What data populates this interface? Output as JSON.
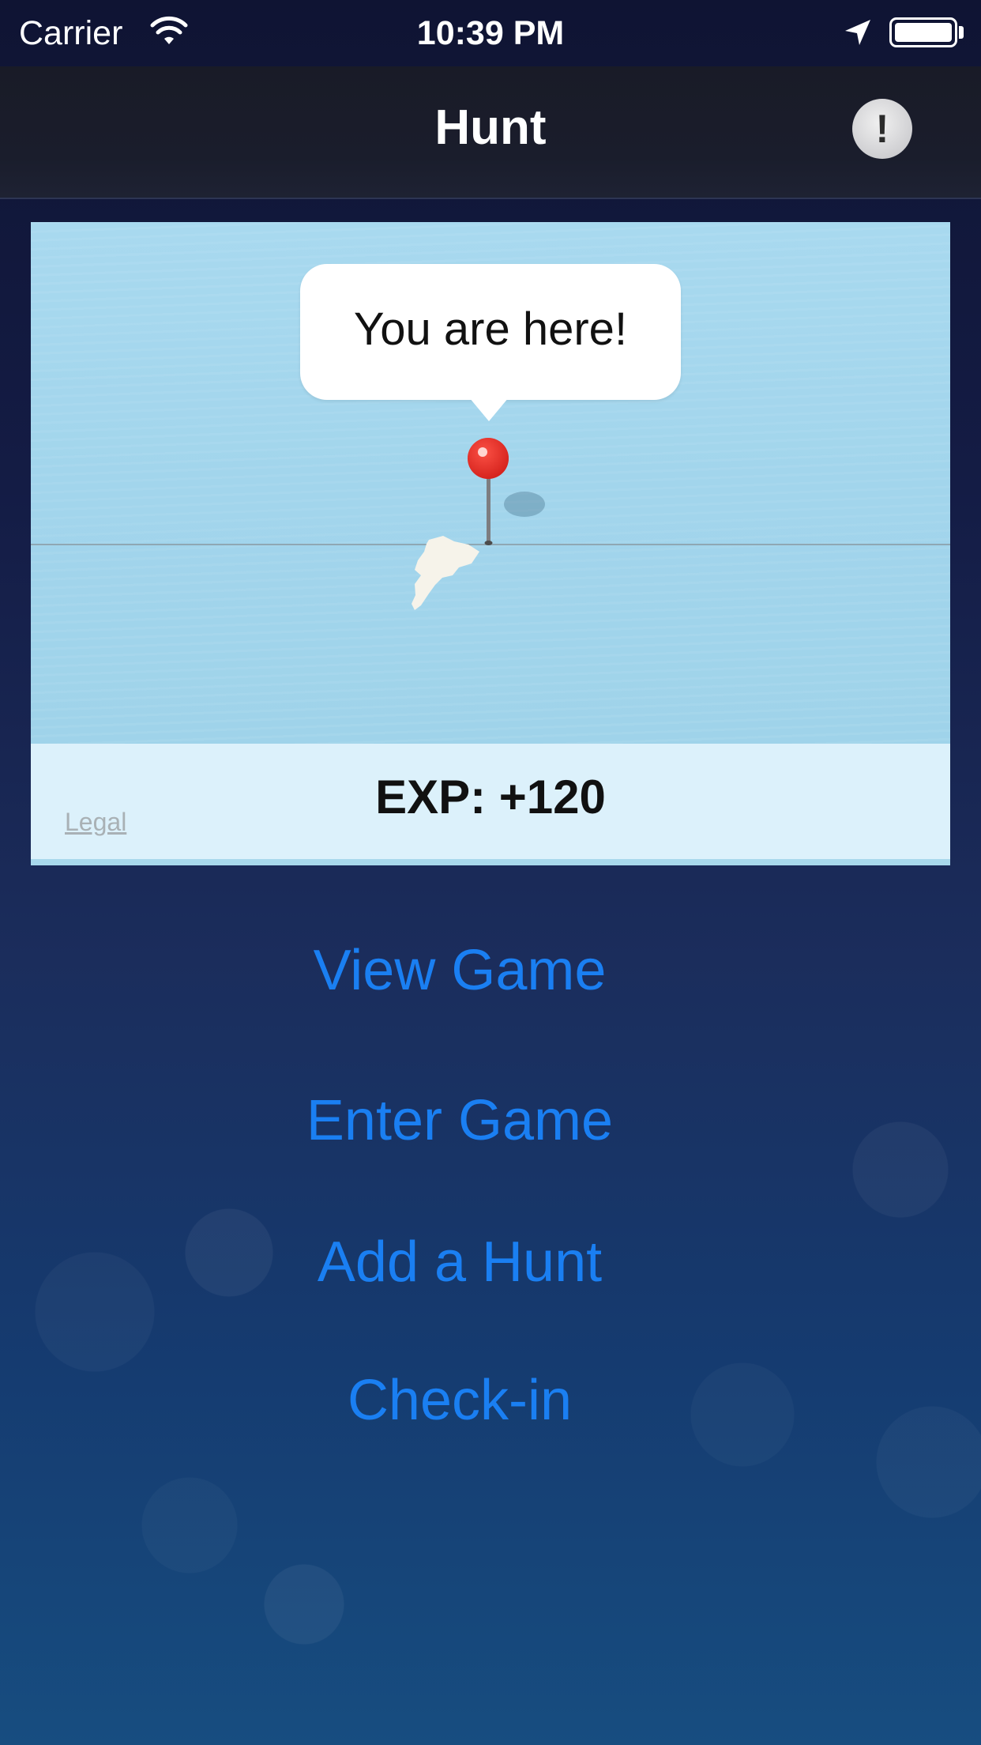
{
  "status_bar": {
    "carrier": "Carrier",
    "time": "10:39 PM",
    "wifi_icon": "wifi-icon",
    "location_icon": "location-arrow-icon",
    "battery_icon": "battery-full-icon"
  },
  "nav_bar": {
    "title": "Hunt",
    "alert_icon": "exclamation-icon",
    "alert_glyph": "!"
  },
  "map": {
    "callout": "You are here!",
    "pin_icon": "red-map-pin-icon",
    "exp": "EXP: +120",
    "legal": "Legal",
    "colors": {
      "water": "#a8d8ec",
      "band": "#dcf1fb",
      "pin": "#f5302a"
    }
  },
  "menu": {
    "buttons": [
      "View Game",
      "Enter Game",
      "Add a Hunt",
      "Check-in"
    ],
    "color": "#1a7ff2"
  }
}
